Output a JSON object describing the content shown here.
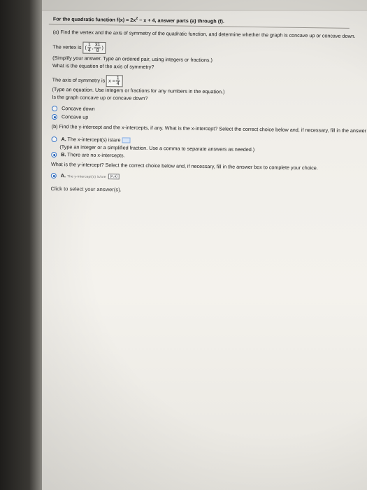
{
  "question": {
    "prompt_prefix": "For the quadratic function f(x) = 2x",
    "prompt_exp": "2",
    "prompt_suffix": " − x + 4, answer parts (a) through (f).",
    "part_a": "(a) Find the vertex and the axis of symmetry of the quadratic function, and determine whether the graph is concave up or concave down.",
    "vertex_label": "The vertex is",
    "vertex_x_num": "1",
    "vertex_x_den": "4",
    "vertex_y_num": "31",
    "vertex_y_den": "8",
    "simplify_note": "(Simplify your answer. Type an ordered pair, using integers or fractions.)",
    "axis_question": "What is the equation of the axis of symmetry?",
    "axis_label": "The axis of symmetry is",
    "axis_var": "x =",
    "axis_num": "1",
    "axis_den": "4",
    "equation_note": "(Type an equation. Use integers or fractions for any numbers in the equation.)",
    "concavity_question": "Is the graph concave up or concave down?",
    "option_down": "Concave down",
    "option_up": "Concave up",
    "part_b": "(b) Find the y-intercept and the x-intercepts, if any. What is the x-intercept? Select the correct choice below and, if necessary, fill in the answer box to complete your choice.",
    "choice_a_letter": "A.",
    "choice_a_text": "The x-intercept(s) is/are",
    "choice_a_note": "(Type an integer or a simplified fraction. Use a comma to separate answers as needed.)",
    "choice_b_letter": "B.",
    "choice_b_text": "There are no x-intercepts.",
    "y_question": "What is the y-intercept? Select the correct choice below and, if necessary, fill in the answer box to complete your choice.",
    "y_choice_a_letter": "A.",
    "y_choice_a_text": "The y-intercept(s) is/are",
    "y_choice_a_box": "(n,a)",
    "footer": "Click to select your answer(s)."
  }
}
